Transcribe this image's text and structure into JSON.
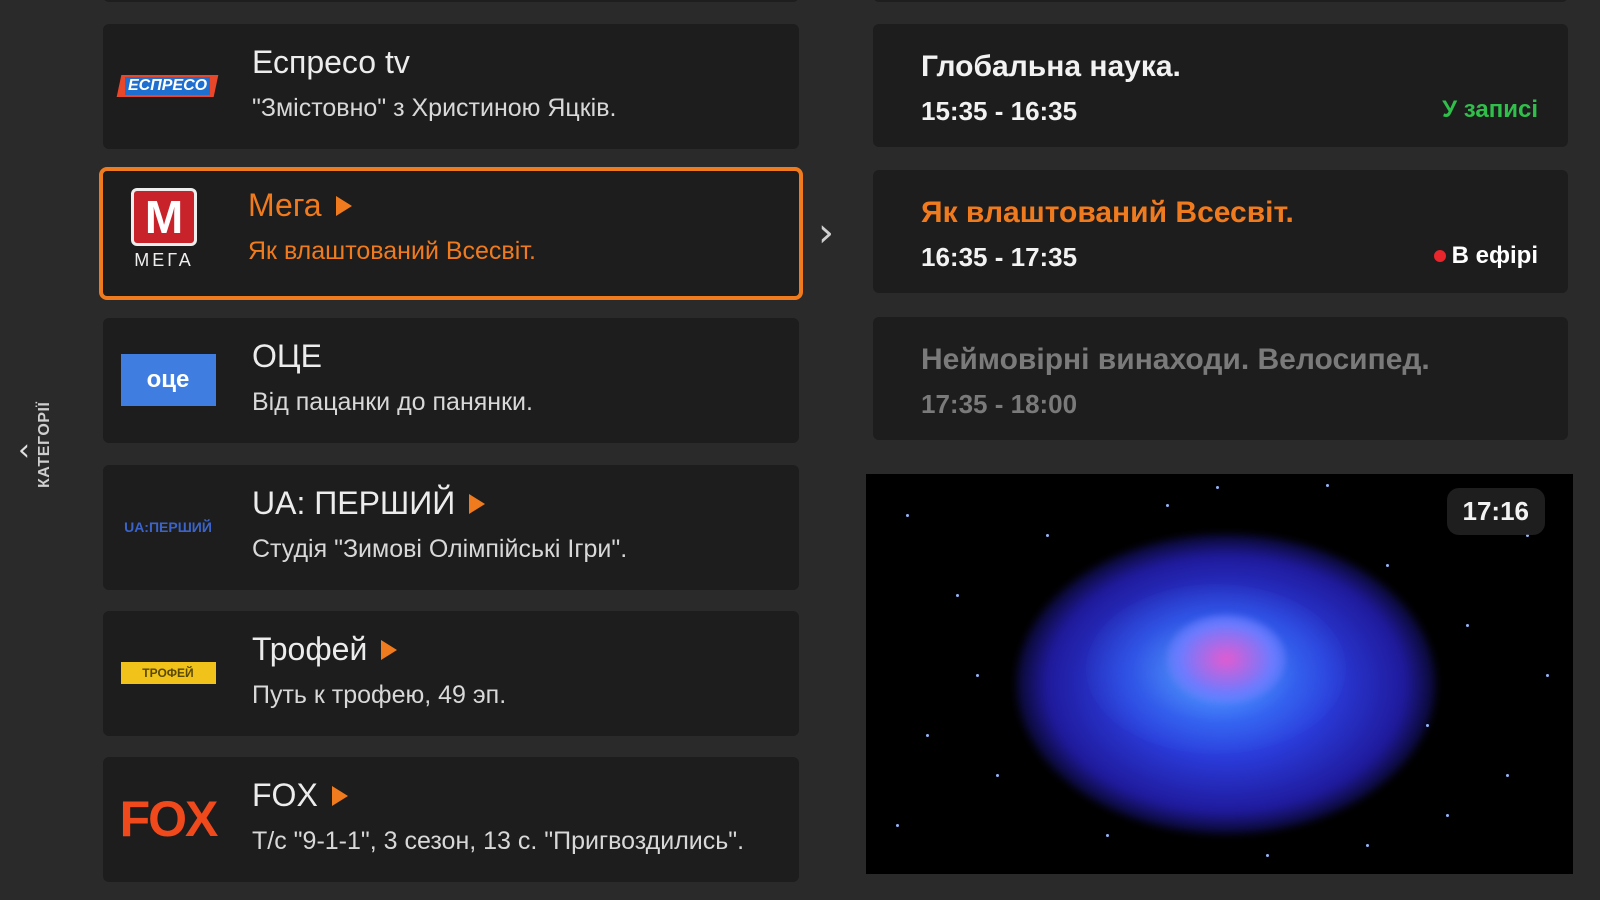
{
  "sidebar": {
    "label": "КАТЕГОРІЇ"
  },
  "channels": [
    {
      "name": "Еспресо tv",
      "show": "\"Змістовно\" з Христиною Яцків.",
      "logo_text": "ЕСПРЕСО"
    },
    {
      "name": "Мега",
      "show": "Як влаштований Всесвіт.",
      "logo_text": "МЕГА",
      "logo_mark": "M"
    },
    {
      "name": "ОЦЕ",
      "show": "Від пацанки до панянки.",
      "logo_text": "оце"
    },
    {
      "name": "UA: ПЕРШИЙ",
      "show": "Студія \"Зимові Олімпійські Ігри\".",
      "logo_text": "UA:ПЕРШИЙ"
    },
    {
      "name": "Трофей",
      "show": "Путь к трофею, 49 эп.",
      "logo_text": "ТРОФЕЙ"
    },
    {
      "name": "FOX",
      "show": "Т/с \"9-1-1\", 3 сезон, 13 с. \"Пригвоздились\".",
      "logo_text": "FOX"
    }
  ],
  "programs": [
    {
      "title": "Глобальна наука.",
      "time": "15:35 - 16:35",
      "status": "У записі"
    },
    {
      "title": "Як влаштований Всесвіт.",
      "time": "16:35 - 17:35",
      "status": "В ефірі"
    },
    {
      "title": "Неймовірні винаходи. Велосипед.",
      "time": "17:35 - 18:00"
    }
  ],
  "player": {
    "clock": "17:16"
  },
  "colors": {
    "accent": "#f07b1e",
    "record": "#2fbf4a",
    "live_dot": "#e8262b"
  }
}
